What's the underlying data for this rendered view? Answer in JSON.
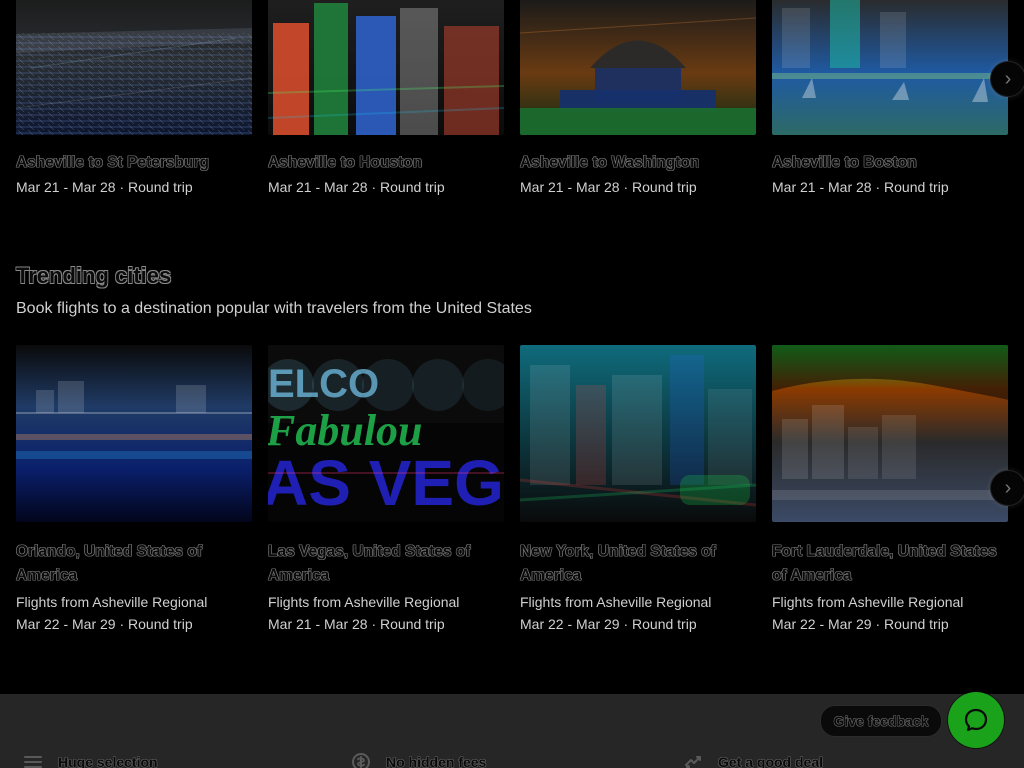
{
  "colors": {
    "background": "#000000",
    "footer": "#262626",
    "chat_button": "#1aa31a"
  },
  "top_row": {
    "cards": [
      {
        "title": "Asheville to St Petersburg",
        "subtitle": "Mar 21 - Mar 28 · Round trip",
        "image_icon": "marina-photo"
      },
      {
        "title": "Asheville to Houston",
        "subtitle": "Mar 21 - Mar 28 · Round trip",
        "image_icon": "skyline-photo"
      },
      {
        "title": "Asheville to Washington",
        "subtitle": "Mar 21 - Mar 28 · Round trip",
        "image_icon": "capitol-photo"
      },
      {
        "title": "Asheville to Boston",
        "subtitle": "Mar 21 - Mar 28 · Round trip",
        "image_icon": "harbor-photo"
      }
    ]
  },
  "trending": {
    "title": "Trending cities",
    "subtitle": "Book flights to a destination popular with travelers from the United States",
    "cards": [
      {
        "title": "Orlando, United States of America",
        "line2": "Flights from Asheville Regional",
        "line3": "Mar 22 - Mar 29 · Round trip",
        "image_icon": "city-reflection-photo"
      },
      {
        "title": "Las Vegas, United States of America",
        "line2": "Flights from Asheville Regional",
        "line3": "Mar 21 - Mar 28 · Round trip",
        "image_icon": "las-vegas-sign-photo",
        "image_text": {
          "top": "ELCO",
          "middle": "Fabulou",
          "bottom": "AS VEG"
        }
      },
      {
        "title": "New York, United States of America",
        "line2": "Flights from Asheville Regional",
        "line3": "Mar 22 - Mar 29 · Round trip",
        "image_icon": "times-square-photo"
      },
      {
        "title": "Fort Lauderdale, United States of America",
        "line2": "Flights from Asheville Regional",
        "line3": "Mar 22 - Mar 29 · Round trip",
        "image_icon": "beach-skyline-photo"
      }
    ]
  },
  "footer": {
    "feedback_label": "Give feedback",
    "items": [
      {
        "label": "Huge selection",
        "icon": "list-icon"
      },
      {
        "label": "No hidden fees",
        "icon": "dollar-icon"
      },
      {
        "label": "Get a good deal",
        "icon": "deal-icon"
      }
    ]
  }
}
